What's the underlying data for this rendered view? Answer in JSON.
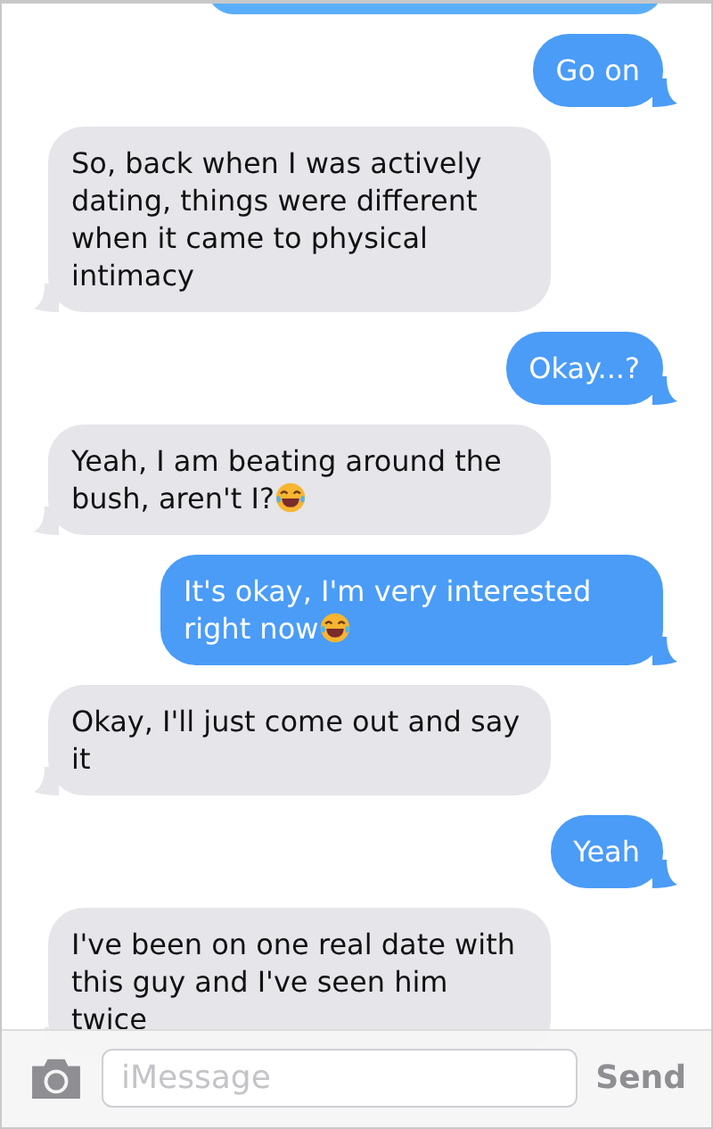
{
  "messages": [
    {
      "kind": "sent",
      "text": "Go on",
      "emoji": false
    },
    {
      "kind": "received",
      "text": "So, back when I was actively dating, things were different when it came to physical intimacy",
      "emoji": false
    },
    {
      "kind": "sent",
      "text": "Okay...?",
      "emoji": false
    },
    {
      "kind": "received",
      "text": "Yeah, I am beating around the bush, aren't I?",
      "emoji": true
    },
    {
      "kind": "sent",
      "text": "It's okay, I'm very interested right now",
      "emoji": true
    },
    {
      "kind": "received",
      "text": "Okay, I'll just come out and say it",
      "emoji": false
    },
    {
      "kind": "sent",
      "text": "Yeah",
      "emoji": false
    },
    {
      "kind": "received",
      "text": "I've been on one real date with this guy and I've seen him twice",
      "emoji": false
    }
  ],
  "composer": {
    "placeholder": "iMessage",
    "send_label": "Send"
  }
}
